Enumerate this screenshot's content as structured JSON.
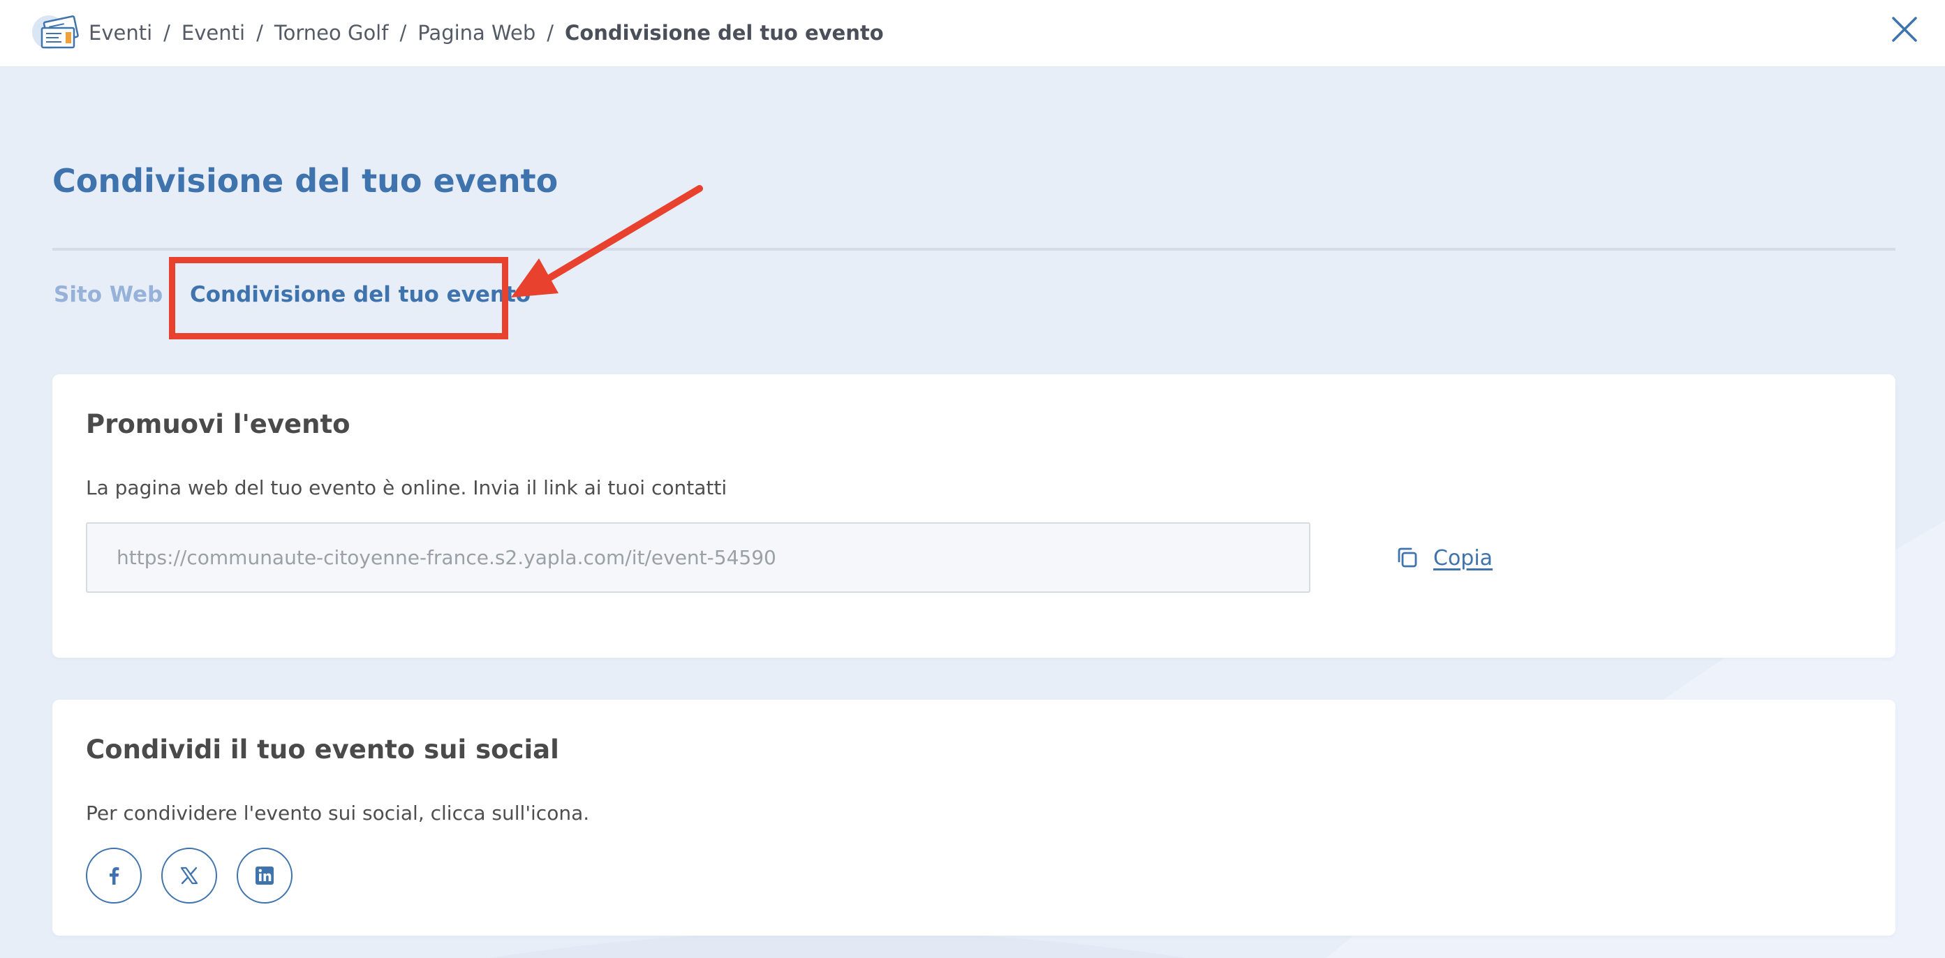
{
  "breadcrumb": {
    "items": [
      "Eventi",
      "Eventi",
      "Torneo Golf",
      "Pagina Web"
    ],
    "current": "Condivisione del tuo evento",
    "separator": "/"
  },
  "page": {
    "title": "Condivisione del tuo evento"
  },
  "tabs": [
    {
      "label": "Sito Web",
      "active": false
    },
    {
      "label": "Condivisione del tuo evento",
      "active": true
    }
  ],
  "promo_card": {
    "title": "Promuovi l'evento",
    "description": "La pagina web del tuo evento è online. Invia il link ai tuoi contatti",
    "link_value": "https://communaute-citoyenne-france.s2.yapla.com/it/event-54590",
    "copy_label": "Copia"
  },
  "social_card": {
    "title": "Condividi il tuo evento sui social",
    "description": "Per condividere l'evento sui social, clicca sull'icona.",
    "networks": [
      "facebook-icon",
      "x-icon",
      "linkedin-icon"
    ]
  },
  "colors": {
    "accent": "#3f73ad",
    "tab_inactive": "#96b2d8",
    "annotation": "#e8412d",
    "background": "#e8eef8"
  }
}
